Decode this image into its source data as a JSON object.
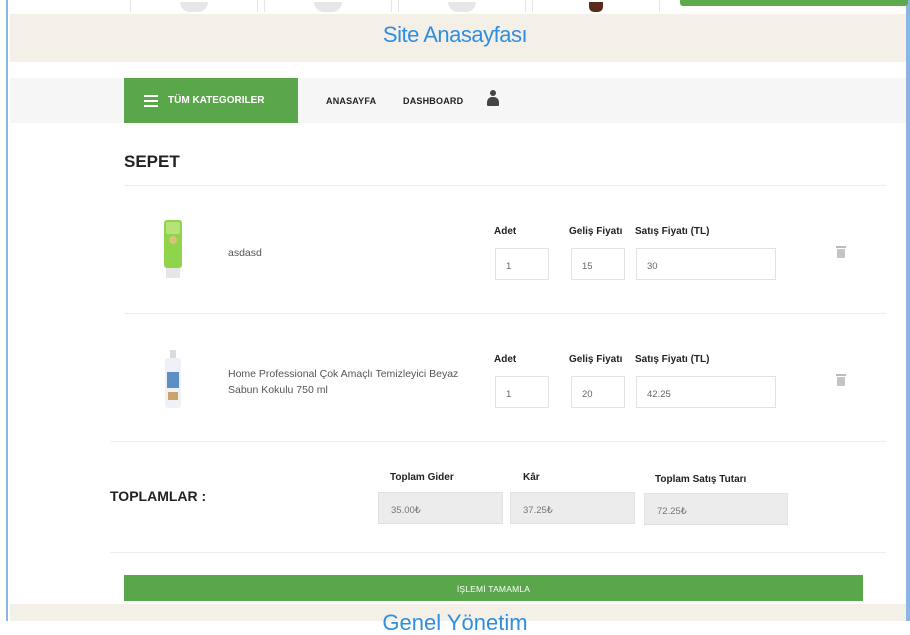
{
  "header": {
    "site_home_link": "Site Anasayfası",
    "bottom_link": "Genel Yönetim"
  },
  "nav": {
    "categories_label": "TÜM KATEGORILER",
    "home_label": "ANASAYFA",
    "dashboard_label": "DASHBOARD",
    "user_icon": "user-icon",
    "menu_icon": "hamburger-icon"
  },
  "cart": {
    "title": "SEPET",
    "items": [
      {
        "name": "asdasd",
        "qty_label": "Adet",
        "qty": "1",
        "cost_label": "Geliş Fiyatı",
        "cost": "15",
        "price_label": "Satış Fiyatı (TL)",
        "price": "30"
      },
      {
        "name": "Home Professional Çok Amaçlı Temizleyici Beyaz Sabun Kokulu 750 ml",
        "qty_label": "Adet",
        "qty": "1",
        "cost_label": "Geliş Fiyatı",
        "cost": "20",
        "price_label": "Satış Fiyatı (TL)",
        "price": "42.25"
      }
    ]
  },
  "totals": {
    "title": "TOPLAMLAR :",
    "expense_label": "Toplam Gider",
    "expense": "35.00₺",
    "profit_label": "Kâr",
    "profit": "37.25₺",
    "sales_label": "Toplam Satış Tutarı",
    "sales": "72.25₺"
  },
  "actions": {
    "complete_label": "İŞLEMİ TAMAMLA"
  },
  "colors": {
    "accent_green": "#5aa64a",
    "link_blue": "#2f8ee0",
    "band_beige": "#f4efe7"
  }
}
